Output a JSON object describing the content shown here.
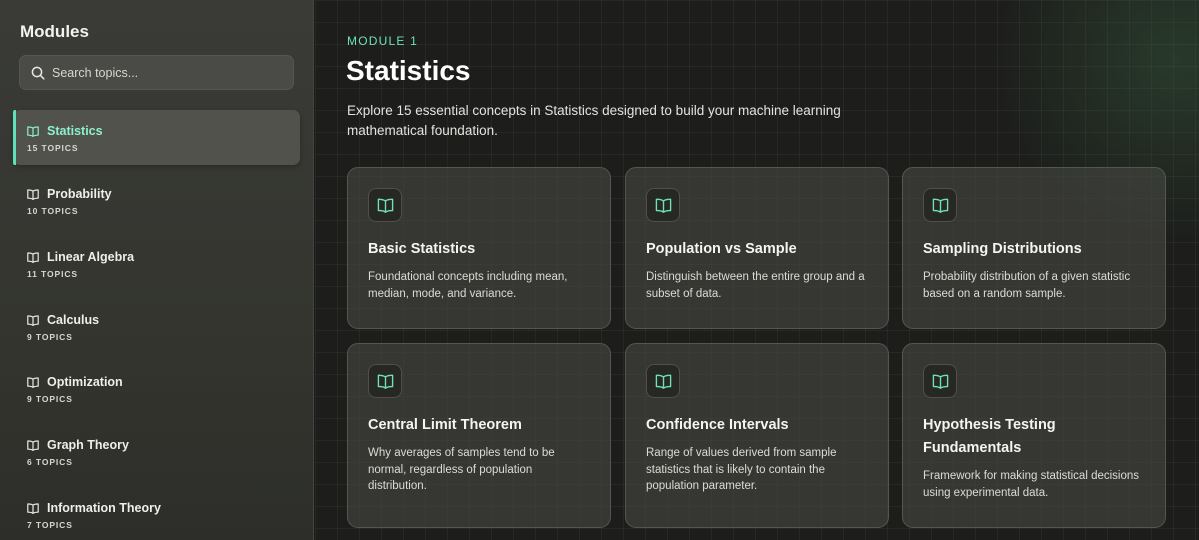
{
  "sidebar": {
    "title": "Modules",
    "search": {
      "placeholder": "Search topics..."
    },
    "items": [
      {
        "label": "Statistics",
        "count": "15 TOPICS",
        "active": true
      },
      {
        "label": "Probability",
        "count": "10 TOPICS",
        "active": false
      },
      {
        "label": "Linear Algebra",
        "count": "11 TOPICS",
        "active": false
      },
      {
        "label": "Calculus",
        "count": "9 TOPICS",
        "active": false
      },
      {
        "label": "Optimization",
        "count": "9 TOPICS",
        "active": false
      },
      {
        "label": "Graph Theory",
        "count": "6 TOPICS",
        "active": false
      },
      {
        "label": "Information Theory",
        "count": "7 TOPICS",
        "active": false
      }
    ]
  },
  "main": {
    "eyebrow": "MODULE 1",
    "title": "Statistics",
    "description": "Explore 15 essential concepts in Statistics designed to build your machine learning mathematical foundation.",
    "cards": [
      {
        "title": "Basic Statistics",
        "description": "Foundational concepts including mean, median, mode, and variance.",
        "icon": "book-icon"
      },
      {
        "title": "Population vs Sample",
        "description": "Distinguish between the entire group and a subset of data.",
        "icon": "book-icon"
      },
      {
        "title": "Sampling Distributions",
        "description": "Probability distribution of a given statistic based on a random sample.",
        "icon": "book-icon"
      },
      {
        "title": "Central Limit Theorem",
        "description": "Why averages of samples tend to be normal, regardless of population distribution.",
        "icon": "book-icon"
      },
      {
        "title": "Confidence Intervals",
        "description": "Range of values derived from sample statistics that is likely to contain the population parameter.",
        "icon": "book-icon"
      },
      {
        "title": "Hypothesis Testing Fundamentals",
        "description": "Framework for making statistical decisions using experimental data.",
        "icon": "book-icon"
      }
    ]
  },
  "colors": {
    "accent": "#6de3bb",
    "background": "#1d1e1c",
    "sidebar": "#3a3b37"
  }
}
